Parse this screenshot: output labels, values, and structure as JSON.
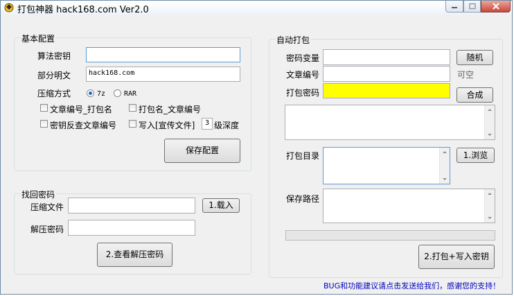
{
  "window": {
    "title": "打包神器 hack168.com Ver2.0"
  },
  "basic": {
    "group_title": "基本配置",
    "algo_key_label": "算法密钥",
    "algo_key_value": "",
    "partial_plain_label": "部分明文",
    "partial_plain_value": "hack168.com",
    "compress_label": "压缩方式",
    "opt_7z": "7z",
    "opt_rar": "RAR",
    "cb1": "文章编号_打包名",
    "cb2": "打包名_文章编号",
    "cb3": "密钥反查文章编号",
    "cb4": "写入[宣传文件]",
    "depth_value": "3",
    "depth_suffix": "级深度",
    "save_btn": "保存配置"
  },
  "recover": {
    "group_title": "找回密码",
    "file_label": "压缩文件",
    "file_value": "",
    "load_btn": "1.载入",
    "pwd_label": "解压密码",
    "pwd_value": "",
    "view_btn": "2.查看解压密码"
  },
  "auto": {
    "group_title": "自动打包",
    "secret_var_label": "密码变量",
    "secret_var_value": "",
    "random_btn": "随机",
    "article_no_label": "文章编号",
    "article_no_value": "",
    "optional_hint": "可空",
    "pack_pwd_label": "打包密码",
    "pack_pwd_value": "",
    "combine_btn": "合成",
    "pack_dir_label": "打包目录",
    "browse_btn": "1.浏览",
    "save_path_label": "保存路径",
    "pack_btn": "2.打包+写入密钥"
  },
  "footer": {
    "text": "BUG和功能建议请点击发送给我们，感谢您的支持！"
  },
  "colors": {
    "pack_pwd_bg": "#ffff00",
    "footer_text": "#0000c0"
  }
}
